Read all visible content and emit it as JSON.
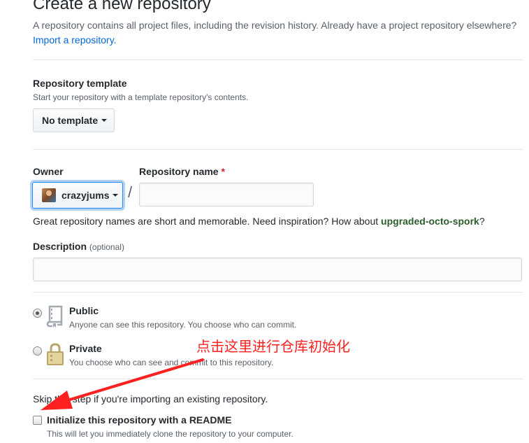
{
  "header": {
    "title": "Create a new repository",
    "subtitle": "A repository contains all project files, including the revision history. Already have a project repository elsewhere?",
    "import_link": "Import a repository."
  },
  "template": {
    "label": "Repository template",
    "note": "Start your repository with a template repository's contents.",
    "button_label": "No template"
  },
  "owner": {
    "label": "Owner",
    "username": "crazyjums"
  },
  "repo_name": {
    "label": "Repository name",
    "required_marker": "*",
    "value": "",
    "separator": "/"
  },
  "name_hint": {
    "text": "Great repository names are short and memorable. Need inspiration? How about ",
    "suggestion": "upgraded-octo-spork",
    "end": "?"
  },
  "description": {
    "label": "Description",
    "optional": "(optional)",
    "value": ""
  },
  "visibility": {
    "public": {
      "label": "Public",
      "note": "Anyone can see this repository. You choose who can commit.",
      "selected": true
    },
    "private": {
      "label": "Private",
      "note": "You choose who can see and commit to this repository.",
      "selected": false
    }
  },
  "init": {
    "skip_note": "Skip this step if you're importing an existing repository.",
    "readme_label": "Initialize this repository with a README",
    "readme_note": "This will let you immediately clone the repository to your computer.",
    "checked": false
  },
  "annotation": {
    "text": "点击这里进行仓库初始化",
    "color": "#ff2020"
  },
  "colors": {
    "link": "#0366d6",
    "suggestion": "#2c5d2c",
    "required": "#cb2431",
    "focus": "#2188ff"
  }
}
